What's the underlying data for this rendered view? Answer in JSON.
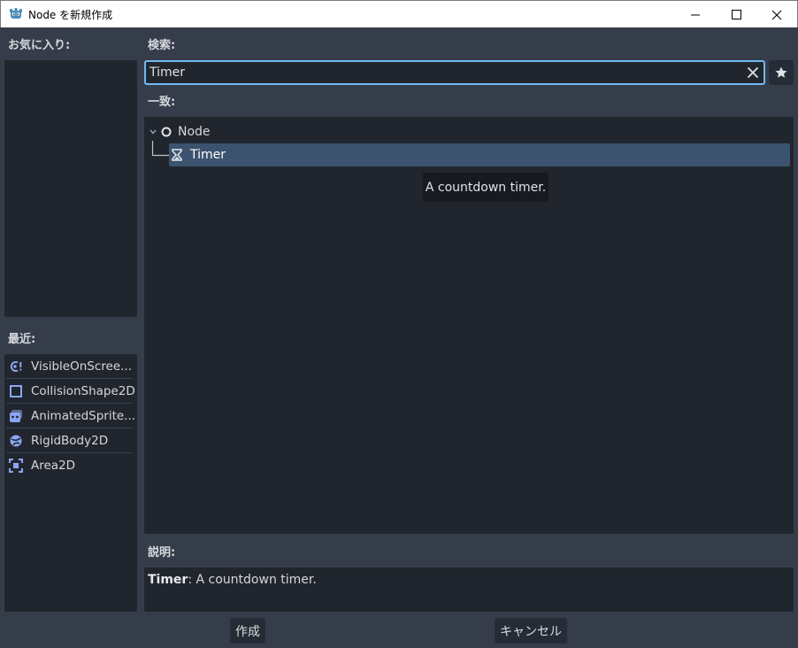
{
  "window": {
    "title": "Node を新規作成",
    "minimize_glyph": "—",
    "maximize_glyph": "☐",
    "close_glyph": "✕"
  },
  "favorites": {
    "label": "お気に入り:"
  },
  "recent": {
    "label": "最近:",
    "items": [
      {
        "label": "VisibleOnScree...",
        "icon": "visible-on-screen-notifier-icon"
      },
      {
        "label": "CollisionShape2D",
        "icon": "collision-shape-2d-icon"
      },
      {
        "label": "AnimatedSprite...",
        "icon": "animated-sprite-2d-icon"
      },
      {
        "label": "RigidBody2D",
        "icon": "rigid-body-2d-icon"
      },
      {
        "label": "Area2D",
        "icon": "area-2d-icon"
      }
    ]
  },
  "search": {
    "label": "検索:",
    "value": "Timer"
  },
  "matches": {
    "label": "一致:",
    "tree": {
      "root": "Node",
      "child": "Timer"
    },
    "tooltip": "A countdown timer."
  },
  "description": {
    "label": "説明:",
    "name": "Timer",
    "text": ": A countdown timer."
  },
  "buttons": {
    "create": "作成",
    "cancel": "キャンセル"
  },
  "colors": {
    "accent": "#70b8f0",
    "background": "#363d4a",
    "panel": "#21262e",
    "selection": "#3b536e",
    "node_2d_icon": "#8da5f3"
  }
}
